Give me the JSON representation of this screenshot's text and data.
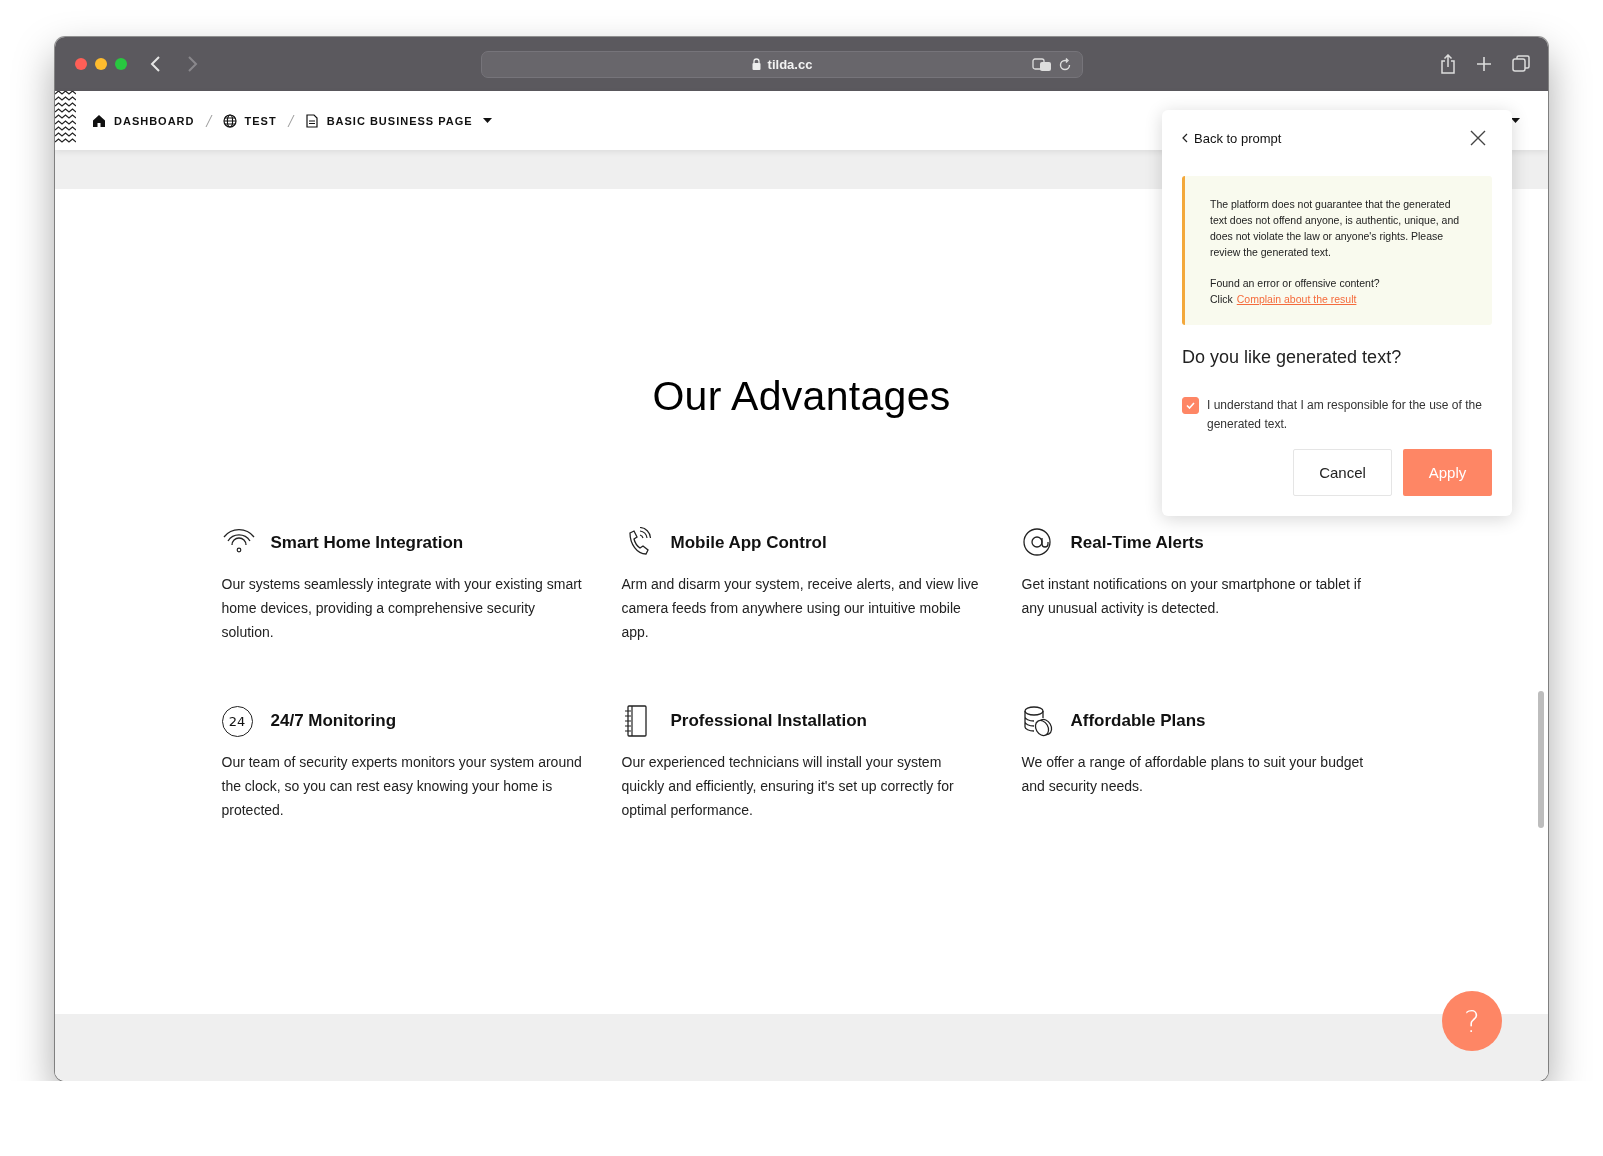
{
  "browser": {
    "url": "tilda.cc"
  },
  "breadcrumbs": [
    {
      "label": "DASHBOARD",
      "kind": "home"
    },
    {
      "label": "TEST",
      "kind": "globe"
    },
    {
      "label": "BASIC BUSINESS PAGE",
      "kind": "page"
    }
  ],
  "section": {
    "title": "Our Advantages"
  },
  "features": [
    {
      "kind": "wifi",
      "title": "Smart Home Integration",
      "text": "Our systems seamlessly integrate with your existing smart home devices, providing a comprehensive security solution."
    },
    {
      "kind": "phone",
      "title": "Mobile App Control",
      "text": "Arm and disarm your system, receive alerts, and view live camera feeds from anywhere using our intuitive mobile app."
    },
    {
      "kind": "at",
      "title": "Real-Time Alerts",
      "text": "Get instant notifications on your smartphone or tablet if any unusual activity is detected."
    },
    {
      "kind": "clock24",
      "icon_label": "24",
      "title": "24/7 Monitoring",
      "text": "Our team of security experts monitors your system around the clock, so you can rest easy knowing your home is protected."
    },
    {
      "kind": "notebook",
      "title": "Professional Installation",
      "text": "Our experienced technicians will install your system quickly and efficiently, ensuring it's set up correctly for optimal performance."
    },
    {
      "kind": "coins",
      "title": "Affordable Plans",
      "text": "We offer a range of affordable plans to suit your budget and security needs."
    }
  ],
  "popup": {
    "back": "Back to prompt",
    "notice": "The platform does not guarantee that the generated text does not offend anyone, is authentic, unique, and does not violate the law or anyone's rights. Please review the generated text.",
    "report_question": "Found an error or offensive content?",
    "report_prefix": "Click",
    "report_link": "Complain about the result",
    "question": "Do you like generated text?",
    "consent": {
      "label": "I understand that I am responsible for the use of the generated text.",
      "checked": true
    },
    "cancel": "Cancel",
    "apply": "Apply"
  },
  "help_button": {
    "label": "?"
  }
}
